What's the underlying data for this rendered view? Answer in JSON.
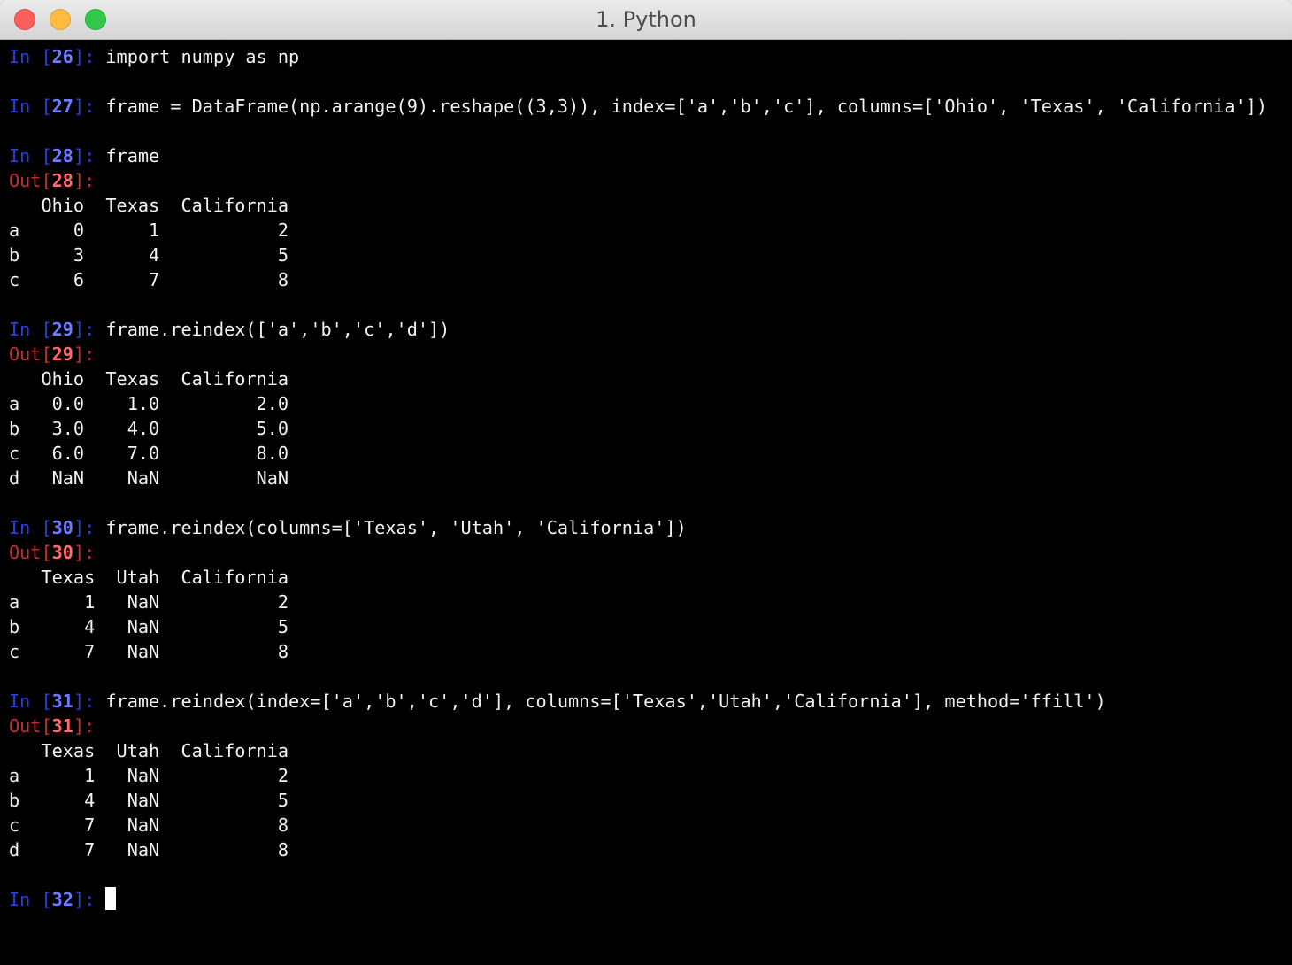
{
  "window": {
    "title": "1. Python",
    "buttons": {
      "close": "close",
      "minimize": "minimize",
      "maximize": "maximize"
    }
  },
  "colors": {
    "prompt_in": "#2a3fd9",
    "prompt_in_number": "#6f7bff",
    "prompt_out": "#c62f2f",
    "prompt_out_number": "#ff6b6b",
    "text": "#f2f2f2",
    "background": "#000000"
  },
  "session": {
    "cells": [
      {
        "in_label": "In ",
        "number": "26",
        "code": "import numpy as np",
        "output": []
      },
      {
        "in_label": "In ",
        "number": "27",
        "code": "frame = DataFrame(np.arange(9).reshape((3,3)), index=['a','b','c'], columns=['Ohio', 'Texas', 'California'])",
        "output": []
      },
      {
        "in_label": "In ",
        "number": "28",
        "code": "frame",
        "out_label": "Out",
        "output": [
          "   Ohio  Texas  California",
          "a     0      1           2",
          "b     3      4           5",
          "c     6      7           8"
        ]
      },
      {
        "in_label": "In ",
        "number": "29",
        "code": "frame.reindex(['a','b','c','d'])",
        "out_label": "Out",
        "output": [
          "   Ohio  Texas  California",
          "a   0.0    1.0         2.0",
          "b   3.0    4.0         5.0",
          "c   6.0    7.0         8.0",
          "d   NaN    NaN         NaN"
        ]
      },
      {
        "in_label": "In ",
        "number": "30",
        "code": "frame.reindex(columns=['Texas', 'Utah', 'California'])",
        "out_label": "Out",
        "output": [
          "   Texas  Utah  California",
          "a      1   NaN           2",
          "b      4   NaN           5",
          "c      7   NaN           8"
        ]
      },
      {
        "in_label": "In ",
        "number": "31",
        "code": "frame.reindex(index=['a','b','c','d'], columns=['Texas','Utah','California'], method='ffill')",
        "out_label": "Out",
        "output": [
          "   Texas  Utah  California",
          "a      1   NaN           2",
          "b      4   NaN           5",
          "c      7   NaN           8",
          "d      7   NaN           8"
        ]
      }
    ],
    "current_prompt": {
      "in_label": "In ",
      "number": "32",
      "input": ""
    }
  }
}
